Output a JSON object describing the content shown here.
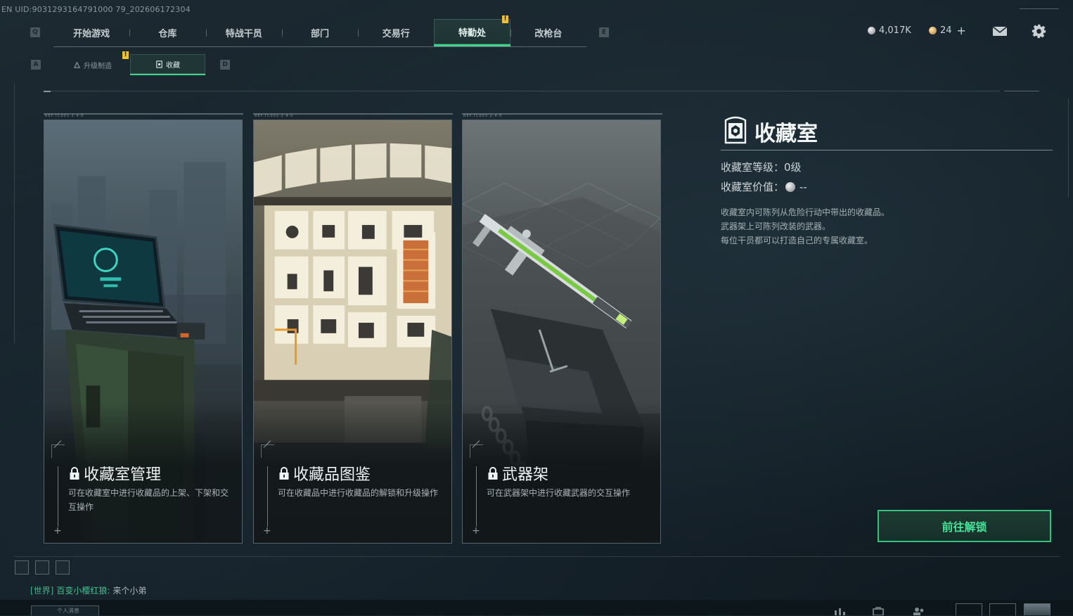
{
  "uid_text": "EN UID:9031293164791000 79_202606172304",
  "nav": {
    "left_key": "Q",
    "right_key": "E",
    "tabs": [
      {
        "label": "开始游戏"
      },
      {
        "label": "仓库"
      },
      {
        "label": "特战干员"
      },
      {
        "label": "部门"
      },
      {
        "label": "交易行"
      },
      {
        "label": "特勤处",
        "active": true
      },
      {
        "label": "改枪台"
      }
    ],
    "alert_badge": "!"
  },
  "currency": {
    "silver_amount": "4,017K",
    "gold_amount": "24",
    "add_symbol": "+"
  },
  "subnav": {
    "left_key": "A",
    "right_key": "D",
    "tabs": [
      {
        "label": "升级制造",
        "icon": "upgrade-icon"
      },
      {
        "label": "收藏",
        "icon": "collection-icon",
        "active": true
      }
    ],
    "alert_badge": "!"
  },
  "cards": [
    {
      "title": "收藏室管理",
      "description": "可在收藏室中进行收藏品的上架、下架和交互操作",
      "locked": true,
      "header_code": "REF.TC001·2·4·0"
    },
    {
      "title": "收藏品图鉴",
      "description": "可在收藏品中进行收藏品的解锁和升级操作",
      "locked": true,
      "header_code": "REF.TC002·2·4·0"
    },
    {
      "title": "武器架",
      "description": "可在武器架中进行收藏武器的交互操作",
      "locked": true,
      "header_code": "REF.TC003·2·4·0"
    }
  ],
  "panel": {
    "title": "收藏室",
    "level_label": "收藏室等级：",
    "level_value": "0级",
    "value_label": "收藏室价值：",
    "value_value": "--",
    "description_lines": [
      "收藏室内可陈列从危险行动中带出的收藏品。",
      "武器架上可陈列改装的武器。",
      "每位干员都可以打造自己的专属收藏室。"
    ],
    "unlock_button": "前往解锁"
  },
  "chat": {
    "channel": "[世界]",
    "name": "百变小樱红狼:",
    "message": "来个小弟"
  },
  "bottom": {
    "button_label": "个人消息"
  },
  "colors": {
    "accent_green": "#3fd38b",
    "alert_yellow": "#f0c232",
    "background": "#16222a"
  }
}
